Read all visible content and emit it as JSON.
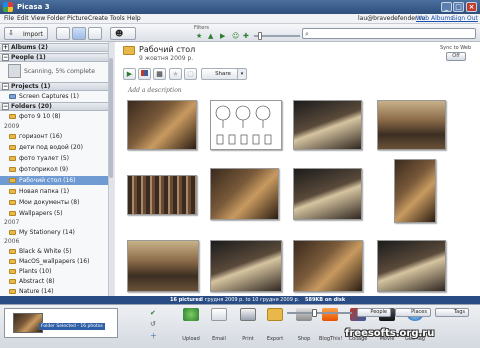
{
  "window": {
    "title": "Picasa 3"
  },
  "menu": {
    "items": [
      "File",
      "Edit",
      "View",
      "Folder",
      "Picture",
      "Create",
      "Tools",
      "Help"
    ],
    "email": "lau@bravedefender.ru",
    "web_albums": "Web Albums",
    "sign_out": "Sign Out"
  },
  "toolbar": {
    "import_label": "Import",
    "filters_label": "Filters"
  },
  "sidebar": {
    "albums_header": "Albums (2)",
    "people_header": "People (1)",
    "people_status": "Scanning, 5% complete",
    "projects_header": "Projects (1)",
    "projects_item": "Screen Captures (1)",
    "folders_header": "Folders (20)",
    "groups": [
      {
        "year": "",
        "items": [
          "фото 9 10 (8)"
        ]
      },
      {
        "year": "2009",
        "items": [
          "горизонт (16)",
          "дети под водой (20)",
          "фото туалет (5)",
          "фотоприкол (9)",
          "Рабочий стол (16)",
          "Новая папка (1)",
          "Мои документы (8)",
          "Wallpapers (5)"
        ]
      },
      {
        "year": "2007",
        "items": [
          "My Stationery (14)"
        ]
      },
      {
        "year": "2006",
        "items": [
          "Black & White (5)",
          "MacOS_wallpapers (16)",
          "Plants (10)",
          "Abstract (8)",
          "Nature (14)"
        ]
      }
    ],
    "selected": "Рабочий стол (16)"
  },
  "album": {
    "title": "Рабочий стол",
    "date": "9 жовтня 2009 р.",
    "sync_label": "Sync to Web",
    "sync_state": "Off",
    "share_label": "Share",
    "description_placeholder": "Add a description"
  },
  "status": {
    "pictures": "16 pictures",
    "range": "8 грудня 2009 р. to 10 грудня 2009 р.",
    "size": "589KB on disk"
  },
  "tray": {
    "selection_label": "Folder Selected - 16 photos",
    "actions": [
      "Upload",
      "Email",
      "Print",
      "Export",
      "Shop",
      "BlogThis!",
      "Collage",
      "Movie",
      "Geo-Tag"
    ],
    "people_label": "People",
    "places_label": "Places",
    "tags_label": "Tags"
  },
  "watermark": "freesofts.org.ru"
}
